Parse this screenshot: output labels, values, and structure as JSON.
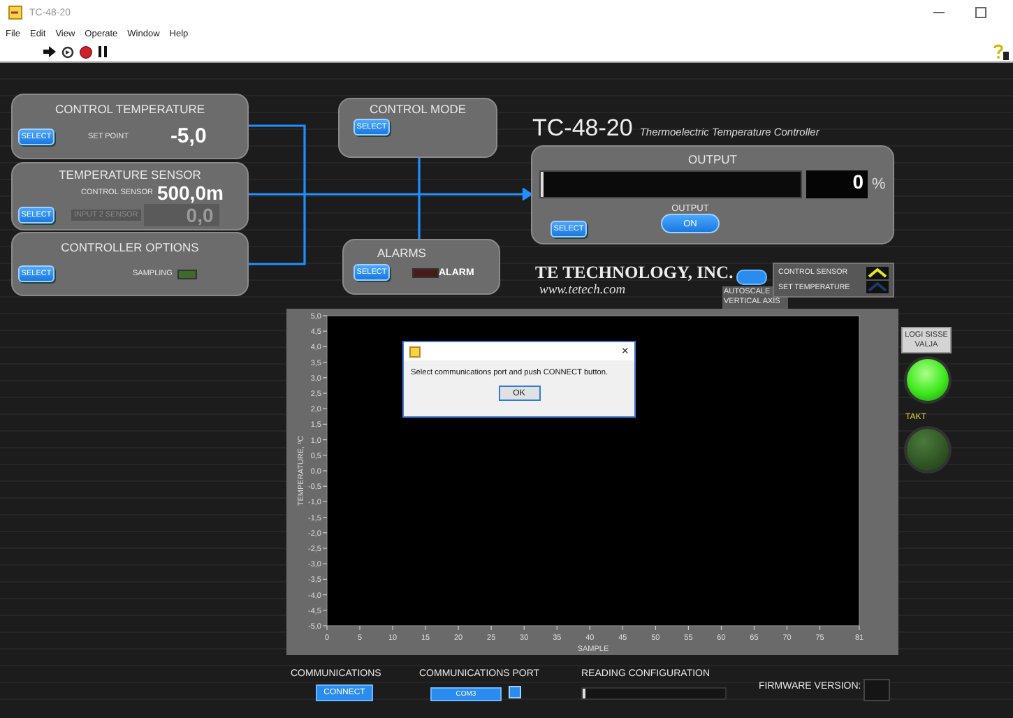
{
  "window": {
    "title": "TC-48-20"
  },
  "menu": [
    "File",
    "Edit",
    "View",
    "Operate",
    "Window",
    "Help"
  ],
  "control_temperature": {
    "title": "CONTROL  TEMPERATURE",
    "button": "SELECT",
    "setpoint_label": "SET POINT",
    "setpoint": "-5,0"
  },
  "temperature_sensor": {
    "title": "TEMPERATURE SENSOR",
    "button": "SELECT",
    "control_sensor_label": "CONTROL SENSOR",
    "control_sensor": "500,0m",
    "input2_label": "INPUT 2 SENSOR",
    "input2": "0,0",
    "input2_disabled": true
  },
  "controller_options": {
    "title": "CONTROLLER OPTIONS",
    "button": "SELECT",
    "sampling_label": "SAMPLING",
    "sampling_on": false
  },
  "control_mode": {
    "title": "CONTROL MODE",
    "button": "SELECT"
  },
  "alarms": {
    "title": "ALARMS",
    "button": "SELECT",
    "indicator_label": "ALARM",
    "alarm_on": false
  },
  "header": {
    "model": "TC-48-20",
    "subtitle": "Thermoelectric Temperature Controller"
  },
  "output": {
    "title": "OUTPUT",
    "level": 0,
    "value": "0",
    "unit": "%",
    "button": "SELECT",
    "switch_label": "OUTPUT",
    "switch_text": "ON",
    "switch_on": true
  },
  "company": {
    "name": "TE TECHNOLOGY, INC.",
    "url": "www.tetech.com"
  },
  "autoscale": {
    "label": "AUTOSCALE VERTICAL AXIS",
    "on": true
  },
  "legend": [
    {
      "name": "CONTROL SENSOR",
      "color": "#e8e820"
    },
    {
      "name": "SET TEMPERATURE",
      "color": "#1c3a66"
    }
  ],
  "chart": {
    "chart_data": {
      "type": "line",
      "xlabel": "SAMPLE",
      "ylabel": "TEMPERATURE, ºC",
      "xlim": [
        0,
        81
      ],
      "ylim": [
        -5,
        5
      ],
      "xticks": [
        0,
        5,
        10,
        15,
        20,
        25,
        30,
        35,
        40,
        45,
        50,
        55,
        60,
        65,
        70,
        75,
        81
      ],
      "yticks": [
        {
          "value": 5,
          "label": "5,0"
        },
        {
          "value": 4.5,
          "label": "4,5"
        },
        {
          "value": 4,
          "label": "4,0"
        },
        {
          "value": 3.5,
          "label": "3,5"
        },
        {
          "value": 3,
          "label": "3,0"
        },
        {
          "value": 2.5,
          "label": "2,5"
        },
        {
          "value": 2,
          "label": "2,0"
        },
        {
          "value": 1.5,
          "label": "1,5"
        },
        {
          "value": 1,
          "label": "1,0"
        },
        {
          "value": 0.5,
          "label": "0,5"
        },
        {
          "value": 0,
          "label": "0,0"
        },
        {
          "value": -0.5,
          "label": "-0,5"
        },
        {
          "value": -1,
          "label": "-1,0"
        },
        {
          "value": -1.5,
          "label": "-1,5"
        },
        {
          "value": -2,
          "label": "-2,0"
        },
        {
          "value": -2.5,
          "label": "-2,5"
        },
        {
          "value": -3,
          "label": "-3,0"
        },
        {
          "value": -3.5,
          "label": "-3,5"
        },
        {
          "value": -4,
          "label": "-4,0"
        },
        {
          "value": -4.5,
          "label": "-4,5"
        },
        {
          "value": -5,
          "label": "-5,0"
        }
      ]
    }
  },
  "side": {
    "button": "LOGI SISSE VALJA",
    "led_on": true,
    "takt_label": "TAKT",
    "takt_on": false
  },
  "footer": {
    "communications_label": "COMMUNICATIONS",
    "connect": "CONNECT",
    "port_label": "COMMUNICATIONS PORT",
    "port": "COM3",
    "reading_label": "READING CONFIGURATION",
    "reading": {
      "level": 0
    },
    "firmware_label": "FIRMWARE VERSION:"
  },
  "dialog": {
    "close": "×",
    "message": "Select communications port and push CONNECT button.",
    "button": "OK"
  }
}
